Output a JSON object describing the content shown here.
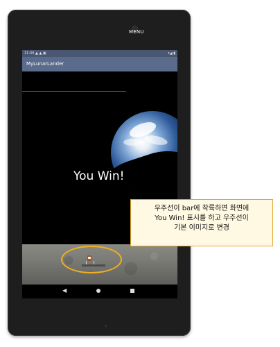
{
  "status_bar": {
    "time": "11:30",
    "left_icons": "▲ ▲ ▣",
    "right_icons": "▾◢ ▮"
  },
  "app": {
    "title": "MyLunarLander",
    "menu_label": "MENU"
  },
  "game": {
    "fuel_level_percent": 67,
    "message": "You Win!"
  },
  "navigation": {
    "back_icon": "◀"
  },
  "callout": {
    "lines": [
      "우주선이 bar에 착륙하면 화면에",
      "You Win! 표시를 하고 우주선이",
      "기본 이미지로 변경"
    ]
  },
  "colors": {
    "app_bar": "#5a6b8c",
    "status_bar": "#495773",
    "fuel_bar": "#e0245e",
    "highlight": "#f2b01e",
    "callout_border": "#e0a829"
  }
}
